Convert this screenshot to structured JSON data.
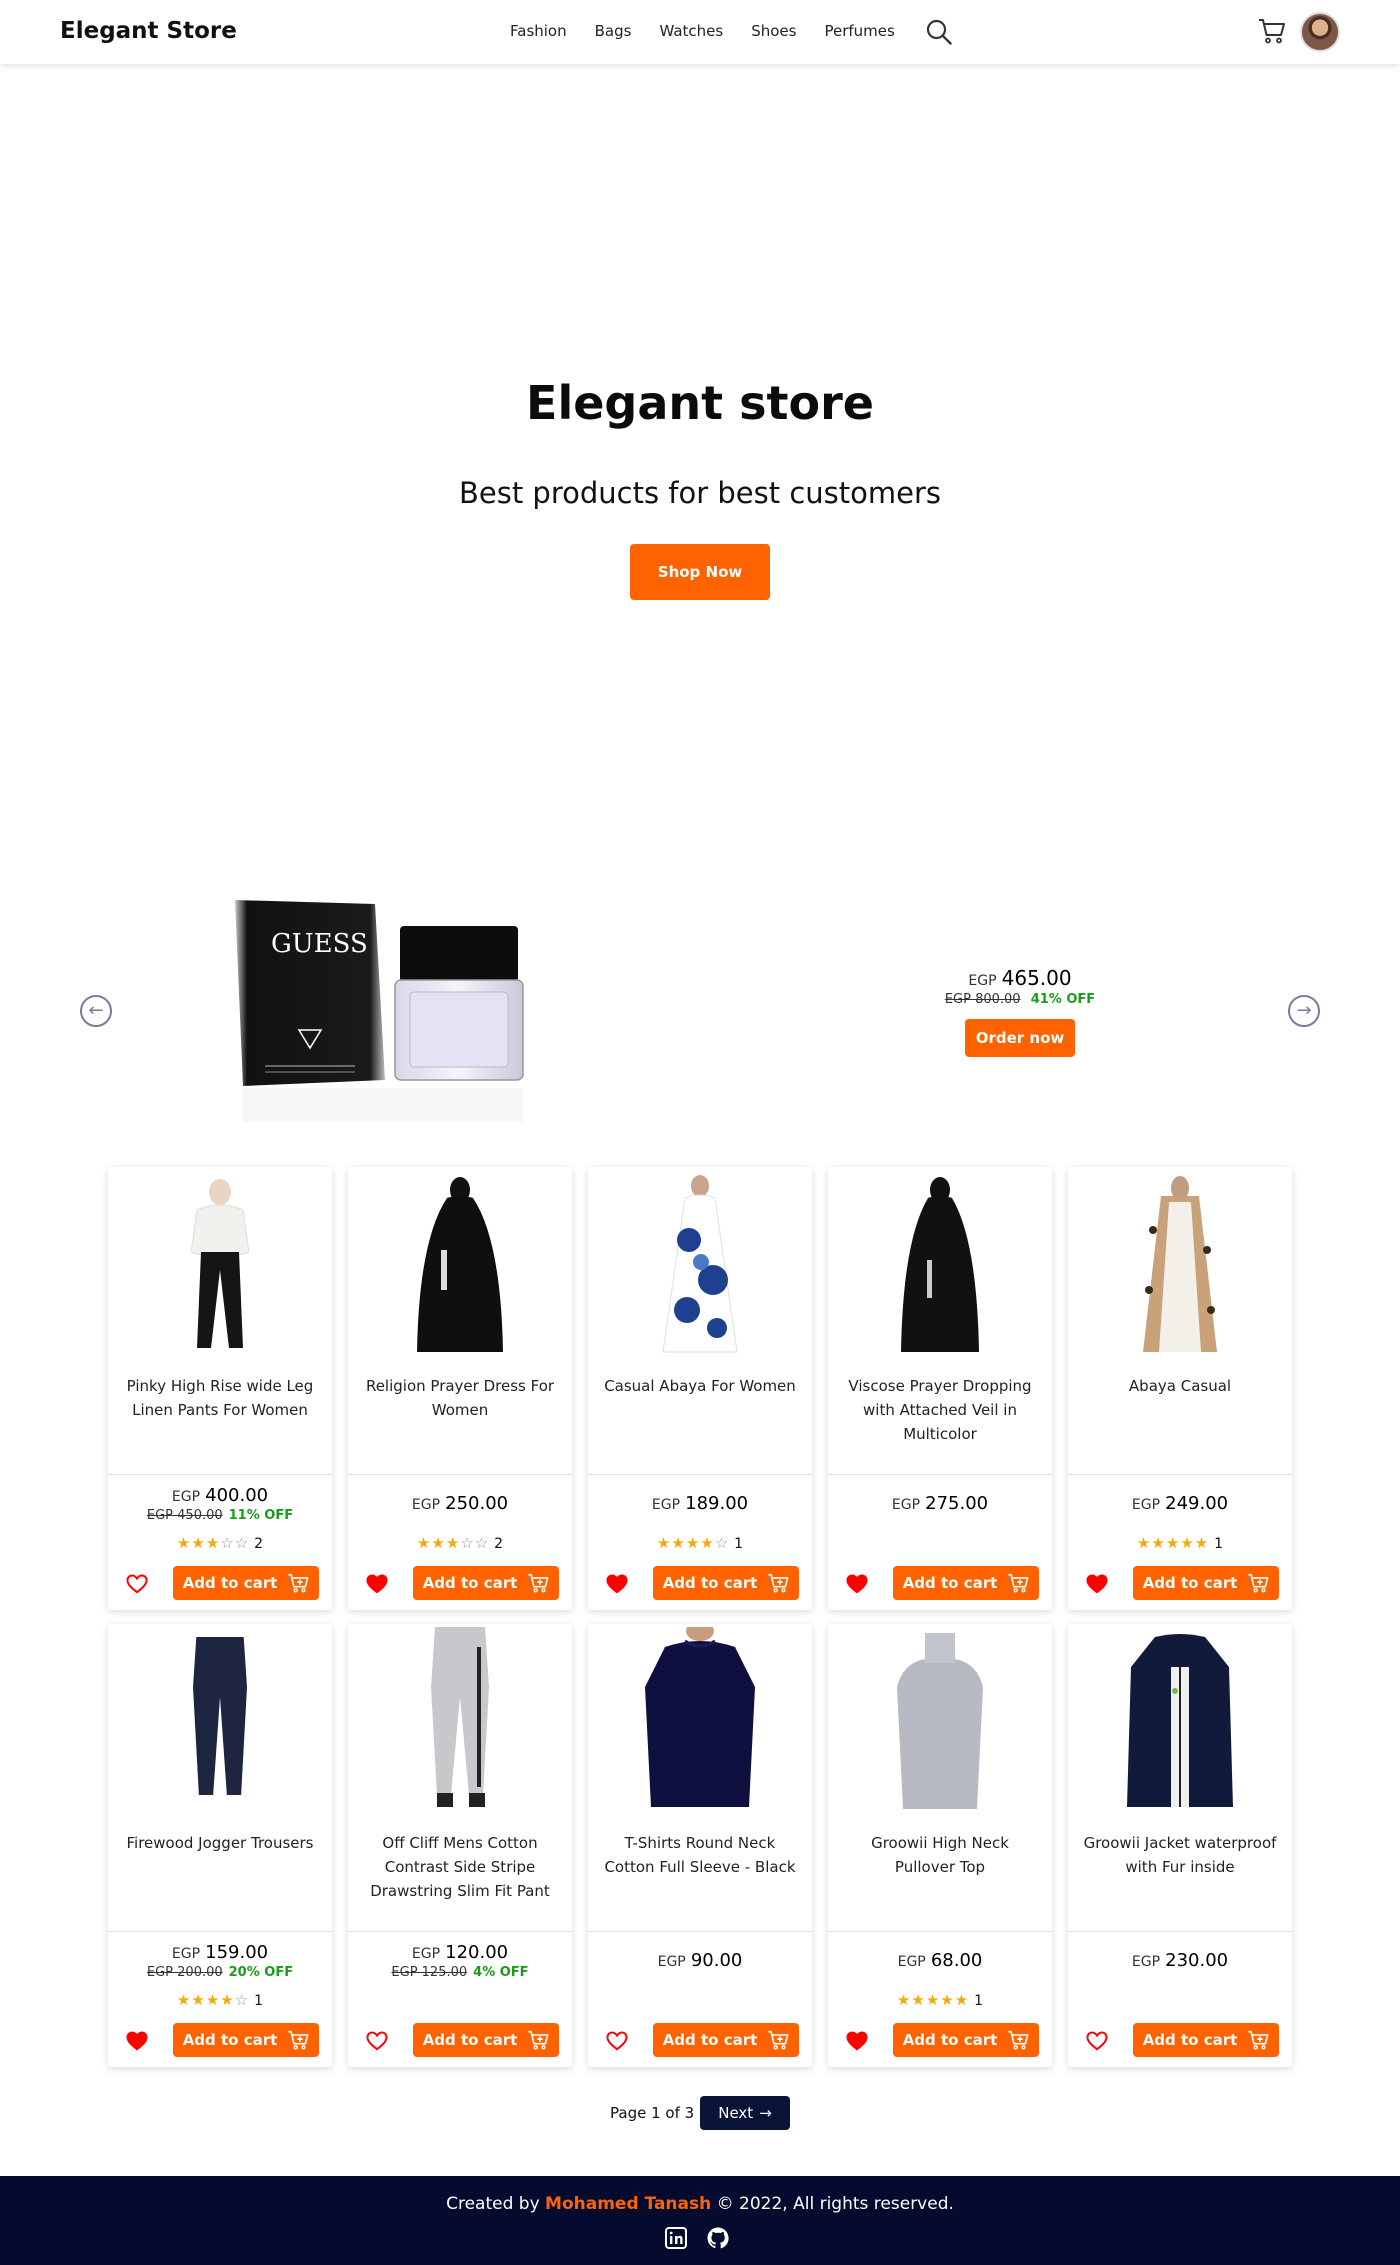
{
  "nav": {
    "brand": "Elegant Store",
    "links": [
      "Fashion",
      "Bags",
      "Watches",
      "Shoes",
      "Perfumes"
    ]
  },
  "hero": {
    "title": "Elegant store",
    "subtitle": "Best products for best customers",
    "cta": "Shop Now"
  },
  "slider": {
    "currency": "EGP",
    "price": "465.00",
    "old_price": "EGP 800.00",
    "discount": "41% OFF",
    "order_label": "Order now",
    "image": "Guess Seductive perfume bottle and box",
    "image_text": "GUESS"
  },
  "products": [
    {
      "title": "Pinky High Rise wide Leg Linen Pants For Women",
      "currency": "EGP",
      "price": "400.00",
      "old_price": "EGP 450.00",
      "discount": "11% OFF",
      "rating": 3,
      "reviews": "2",
      "liked": false,
      "image": "woman white sweater black pants"
    },
    {
      "title": "Religion Prayer Dress For Women",
      "currency": "EGP",
      "price": "250.00",
      "old_price": "",
      "discount": "",
      "rating": 3,
      "reviews": "2",
      "liked": true,
      "image": "black prayer dress"
    },
    {
      "title": "Casual Abaya For Women",
      "currency": "EGP",
      "price": "189.00",
      "old_price": "",
      "discount": "",
      "rating": 4,
      "reviews": "1",
      "liked": true,
      "image": "blue white patterned abaya"
    },
    {
      "title": "Viscose Prayer Dropping with Attached Veil in Multicolor",
      "currency": "EGP",
      "price": "275.00",
      "old_price": "",
      "discount": "",
      "rating": 0,
      "reviews": "",
      "liked": true,
      "image": "black prayer dress with veil"
    },
    {
      "title": "Abaya Casual",
      "currency": "EGP",
      "price": "249.00",
      "old_price": "",
      "discount": "",
      "rating": 5,
      "reviews": "1",
      "liked": true,
      "image": "white abaya leopard print"
    },
    {
      "title": "Firewood Jogger Trousers",
      "currency": "EGP",
      "price": "159.00",
      "old_price": "EGP 200.00",
      "discount": "20% OFF",
      "rating": 4,
      "reviews": "1",
      "liked": true,
      "image": "navy jogger trousers"
    },
    {
      "title": "Off Cliff Mens Cotton Contrast Side Stripe Drawstring Slim Fit Pant",
      "currency": "EGP",
      "price": "120.00",
      "old_price": "EGP 125.00",
      "discount": "4% OFF",
      "rating": 0,
      "reviews": "",
      "liked": false,
      "image": "grey pants side stripe"
    },
    {
      "title": "T-Shirts Round Neck Cotton Full Sleeve - Black",
      "currency": "EGP",
      "price": "90.00",
      "old_price": "",
      "discount": "",
      "rating": 0,
      "reviews": "",
      "liked": false,
      "image": "navy long sleeve t-shirt"
    },
    {
      "title": "Groowii High Neck Pullover Top",
      "currency": "EGP",
      "price": "68.00",
      "old_price": "",
      "discount": "",
      "rating": 5,
      "reviews": "1",
      "liked": true,
      "image": "grey turtleneck pullover"
    },
    {
      "title": "Groowii Jacket waterproof with Fur inside",
      "currency": "EGP",
      "price": "230.00",
      "old_price": "",
      "discount": "",
      "rating": 0,
      "reviews": "",
      "liked": false,
      "image": "navy bomber jacket"
    }
  ],
  "add_to_cart_label": "Add to cart",
  "pagination": {
    "text": "Page 1 of 3",
    "next_label": "Next"
  },
  "footer": {
    "prefix": "Created by",
    "name": "Mohamed Tanash",
    "suffix": "© 2022, All rights reserved."
  },
  "colors": {
    "accent": "#ff6200",
    "navy": "#050b2e",
    "discount_green": "#1a9c1a",
    "star": "#f4a80e",
    "heart": "#ff0000"
  },
  "icons": [
    "search-icon",
    "cart-icon",
    "arrow-left-icon",
    "arrow-right-icon",
    "heart-icon",
    "add-cart-icon",
    "linkedin-icon",
    "github-icon"
  ]
}
